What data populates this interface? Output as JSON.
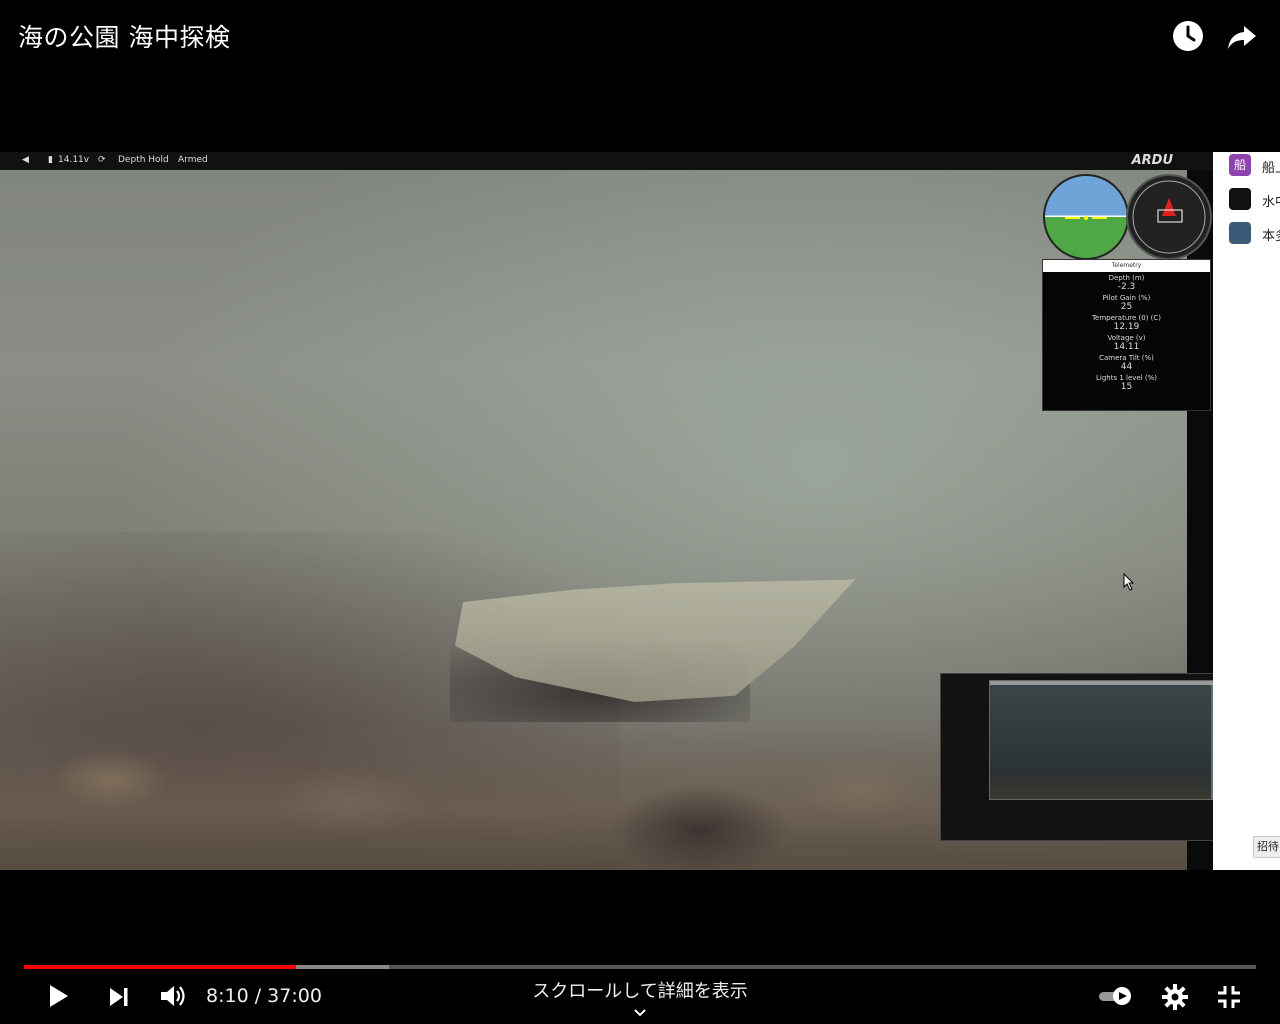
{
  "header": {
    "title": "海の公園 海中探検",
    "watch_later_icon": "clock-icon",
    "share_icon": "share-arrow-icon"
  },
  "video": {
    "hud": {
      "voltage": "14.11v",
      "mode": "Depth Hold",
      "arm_state": "Armed",
      "logo": "ARDU",
      "telemetry": {
        "window_title": "Telemetry",
        "rows": [
          {
            "label": "Depth (m)",
            "value": "-2.3"
          },
          {
            "label": "Pilot Gain (%)",
            "value": "25"
          },
          {
            "label": "Temperature (0) (C)",
            "value": "12.19"
          },
          {
            "label": "Voltage (v)",
            "value": "14.11"
          },
          {
            "label": "Camera Tilt (%)",
            "value": "44"
          },
          {
            "label": "Lights 1 level (%)",
            "value": "15"
          }
        ]
      }
    }
  },
  "side_panel": {
    "items": [
      {
        "icon": "船",
        "label": "船上",
        "color": "#8e44ad"
      },
      {
        "icon": "",
        "label": "水中",
        "color": "#111111"
      },
      {
        "icon": "",
        "label": "本多",
        "color": "#3b5a78"
      }
    ],
    "invite_label": "招待"
  },
  "player": {
    "progress_played": 0.221,
    "progress_buffered": 0.296,
    "current_time": "8:10",
    "duration": "37:00",
    "time_display": "8:10 / 37:00",
    "scroll_hint": "スクロールして詳細を表示",
    "play_icon": "play-icon",
    "next_icon": "next-track-icon",
    "volume_icon": "volume-icon",
    "autoplay_icon": "autoplay-toggle-icon",
    "settings_icon": "gear-icon",
    "fullscreen_exit_icon": "exit-fullscreen-icon",
    "accent_color": "#ff0000"
  }
}
